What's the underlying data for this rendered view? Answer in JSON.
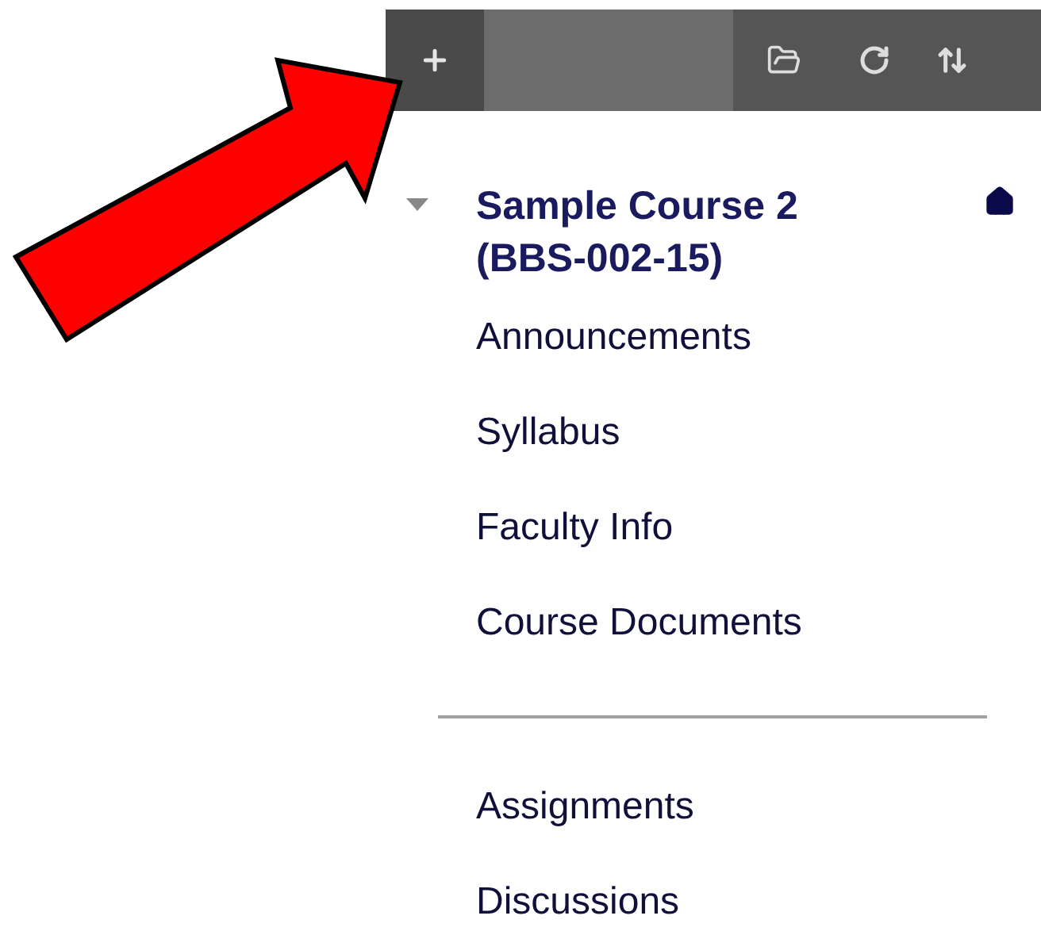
{
  "course": {
    "title": "Sample Course 2 (BBS-002-15)",
    "expanded": true
  },
  "groups": [
    {
      "items": [
        "Announcements",
        "Syllabus",
        "Faculty Info",
        "Course Documents"
      ]
    },
    {
      "items": [
        "Assignments",
        "Discussions"
      ]
    }
  ]
}
